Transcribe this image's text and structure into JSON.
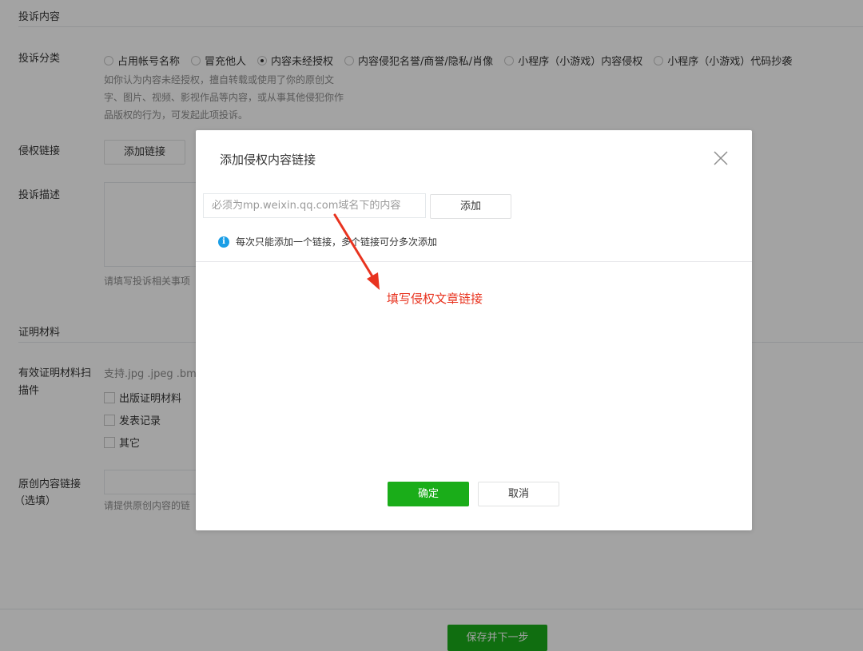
{
  "form": {
    "section_complaint": "投诉内容",
    "category_label": "投诉分类",
    "categories": [
      {
        "label": "占用帐号名称",
        "checked": false
      },
      {
        "label": "冒充他人",
        "checked": false
      },
      {
        "label": "内容未经授权",
        "checked": true
      },
      {
        "label": "内容侵犯名誉/商誉/隐私/肖像",
        "checked": false
      },
      {
        "label": "小程序（小游戏）内容侵权",
        "checked": false
      },
      {
        "label": "小程序（小游戏）代码抄袭",
        "checked": false
      }
    ],
    "category_desc_lines": [
      "如你认为内容未经授权，擅自转载或使用了你的原创文",
      "字、图片、视频、影视作品等内容，或从事其他侵犯你作",
      "品版权的行为，可发起此项投诉。"
    ],
    "infringe_link_label": "侵权链接",
    "add_link_button": "添加链接",
    "description_label": "投诉描述",
    "description_hint": "请填写投诉相关事项",
    "section_evidence": "证明材料",
    "evidence_label_line1": "有效证明材料扫",
    "evidence_label_line2": "描件",
    "evidence_support": "支持.jpg .jpeg .bm",
    "evidence_options": [
      "出版证明材料",
      "发表记录",
      "其它"
    ],
    "original_link_label_line1": "原创内容链接",
    "original_link_label_line2": "（选填）",
    "original_link_hint": "请提供原创内容的链",
    "save_next_button": "保存并下一步"
  },
  "dialog": {
    "title": "添加侵权内容链接",
    "input_placeholder": "必须为mp.weixin.qq.com域名下的内容",
    "add_button": "添加",
    "info_icon_glyph": "i",
    "tip": "每次只能添加一个链接，多个链接可分多次添加",
    "annotation": "填写侵权文章链接",
    "ok_button": "确定",
    "cancel_button": "取消"
  },
  "colors": {
    "primary": "#1aad19",
    "annotation": "#e8331f",
    "info": "#1a9ee6"
  },
  "icons": {
    "close": "close-icon",
    "info": "info-icon",
    "arrow": "arrow-annotation-icon"
  }
}
